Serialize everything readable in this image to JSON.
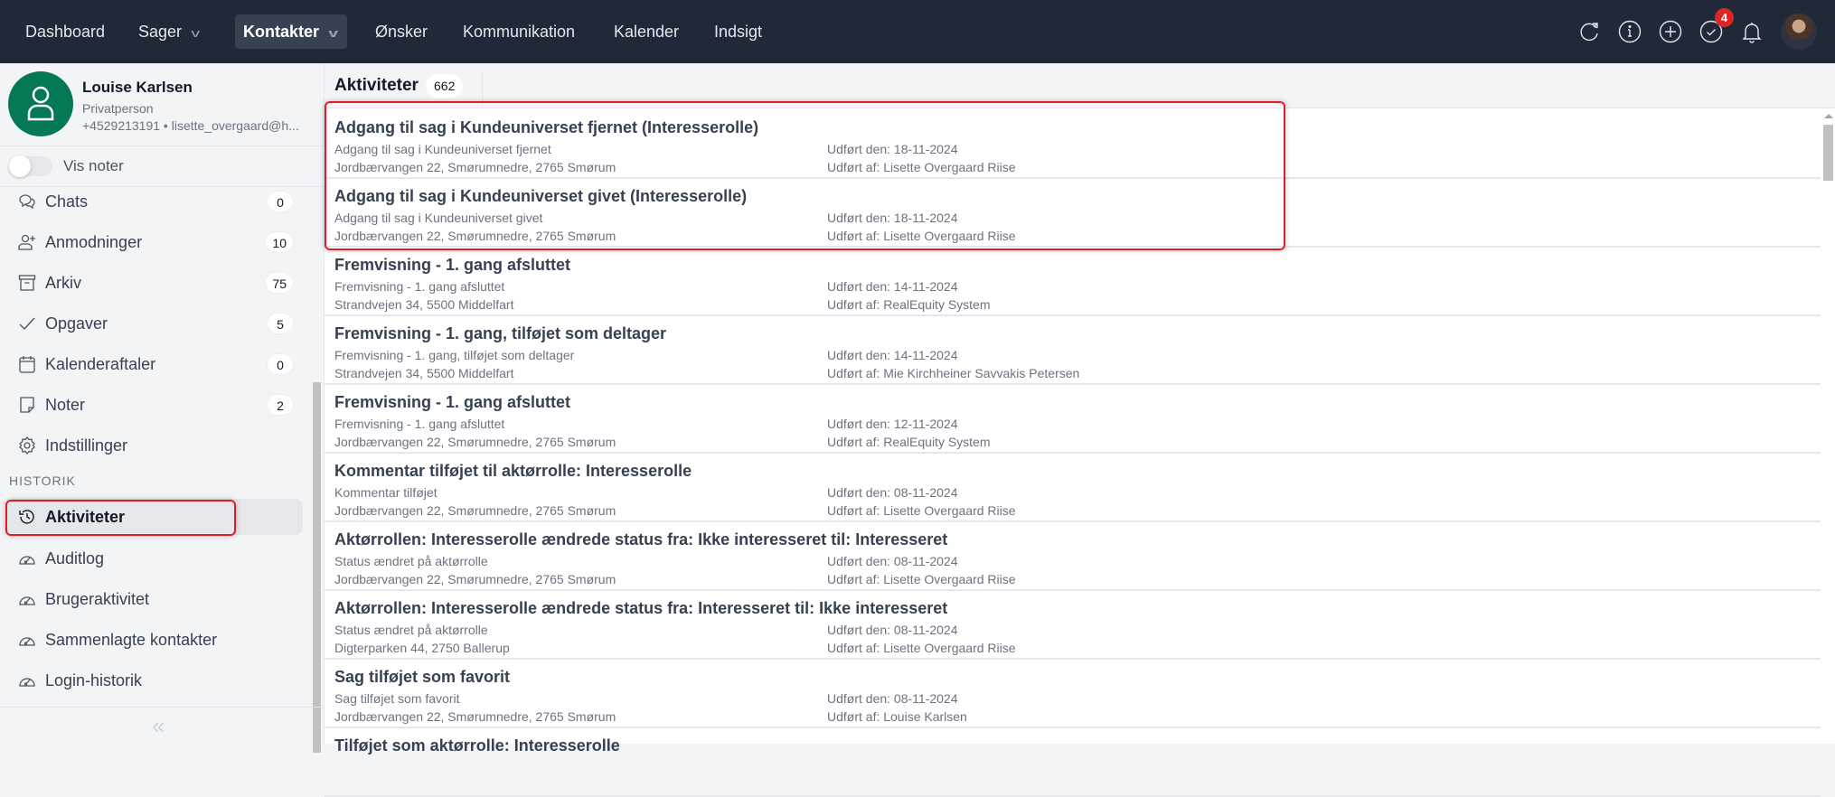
{
  "nav": {
    "items": [
      {
        "label": "Dashboard",
        "dropdown": false
      },
      {
        "label": "Sager",
        "dropdown": true
      },
      {
        "label": "Kontakter",
        "dropdown": true,
        "active": true
      },
      {
        "label": "Ønsker",
        "dropdown": false
      },
      {
        "label": "Kommunikation",
        "dropdown": false
      },
      {
        "label": "Kalender",
        "dropdown": false
      },
      {
        "label": "Indsigt",
        "dropdown": false
      }
    ],
    "icons": [
      "refresh-icon",
      "info-icon",
      "plus-icon",
      "check-icon",
      "bell-icon"
    ],
    "tasks_badge": "4"
  },
  "contact": {
    "name": "Louise Karlsen",
    "type": "Privatperson",
    "details": "+4529213191 • lisette_overgaard@h..."
  },
  "sidebar": {
    "toggle_label": "Vis noter",
    "items": [
      {
        "label": "Chats",
        "count": "0"
      },
      {
        "label": "Anmodninger",
        "count": "10"
      },
      {
        "label": "Arkiv",
        "count": "75"
      },
      {
        "label": "Opgaver",
        "count": "5"
      },
      {
        "label": "Kalenderaftaler",
        "count": "0"
      },
      {
        "label": "Noter",
        "count": "2"
      },
      {
        "label": "Indstillinger"
      }
    ],
    "section": "HISTORIK",
    "history": [
      {
        "label": "Aktiviteter"
      },
      {
        "label": "Auditlog"
      },
      {
        "label": "Brugeraktivitet"
      },
      {
        "label": "Sammenlagte kontakter"
      },
      {
        "label": "Login-historik"
      }
    ],
    "collapse": "«"
  },
  "main": {
    "title": "Aktiviteter",
    "count": "662",
    "rows": [
      {
        "title": "Adgang til sag i Kundeuniverset fjernet (Interesserolle)",
        "sub": "Adgang til sag i Kundeuniverset fjernet",
        "address": "Jordbærvangen 22, Smørumnedre, 2765 Smørum",
        "date": "Udført den: 18-11-2024",
        "by": "Udført af: Lisette Overgaard Riise"
      },
      {
        "title": "Adgang til sag i Kundeuniverset givet (Interesserolle)",
        "sub": "Adgang til sag i Kundeuniverset givet",
        "address": "Jordbærvangen 22, Smørumnedre, 2765 Smørum",
        "date": "Udført den: 18-11-2024",
        "by": "Udført af: Lisette Overgaard Riise"
      },
      {
        "title": "Fremvisning - 1. gang afsluttet",
        "sub": "Fremvisning - 1. gang afsluttet",
        "address": "Strandvejen 34, 5500 Middelfart",
        "date": "Udført den: 14-11-2024",
        "by": "Udført af: RealEquity System"
      },
      {
        "title": "Fremvisning - 1. gang, tilføjet som deltager",
        "sub": "Fremvisning - 1. gang, tilføjet som deltager",
        "address": "Strandvejen 34, 5500 Middelfart",
        "date": "Udført den: 14-11-2024",
        "by": "Udført af: Mie Kirchheiner Savvakis Petersen"
      },
      {
        "title": "Fremvisning - 1. gang afsluttet",
        "sub": "Fremvisning - 1. gang afsluttet",
        "address": "Jordbærvangen 22, Smørumnedre, 2765 Smørum",
        "date": "Udført den: 12-11-2024",
        "by": "Udført af: RealEquity System"
      },
      {
        "title": "Kommentar tilføjet til aktørrolle: Interesserolle",
        "sub": "Kommentar tilføjet",
        "address": "Jordbærvangen 22, Smørumnedre, 2765 Smørum",
        "date": "Udført den: 08-11-2024",
        "by": "Udført af: Lisette Overgaard Riise"
      },
      {
        "title": "Aktørrollen: Interesserolle ændrede status fra: Ikke interesseret til: Interesseret",
        "sub": "Status ændret på aktørrolle",
        "address": "Jordbærvangen 22, Smørumnedre, 2765 Smørum",
        "date": "Udført den: 08-11-2024",
        "by": "Udført af: Lisette Overgaard Riise"
      },
      {
        "title": "Aktørrollen: Interesserolle ændrede status fra: Interesseret til: Ikke interesseret",
        "sub": "Status ændret på aktørrolle",
        "address": "Digterparken 44, 2750 Ballerup",
        "date": "Udført den: 08-11-2024",
        "by": "Udført af: Lisette Overgaard Riise"
      },
      {
        "title": "Sag tilføjet som favorit",
        "sub": "Sag tilføjet som favorit",
        "address": "Jordbærvangen 22, Smørumnedre, 2765 Smørum",
        "date": "Udført den: 08-11-2024",
        "by": "Udført af: Louise Karlsen"
      },
      {
        "title": "Tilføjet som aktørrolle: Interesserolle",
        "sub": "",
        "address": "",
        "date": "",
        "by": ""
      }
    ]
  }
}
